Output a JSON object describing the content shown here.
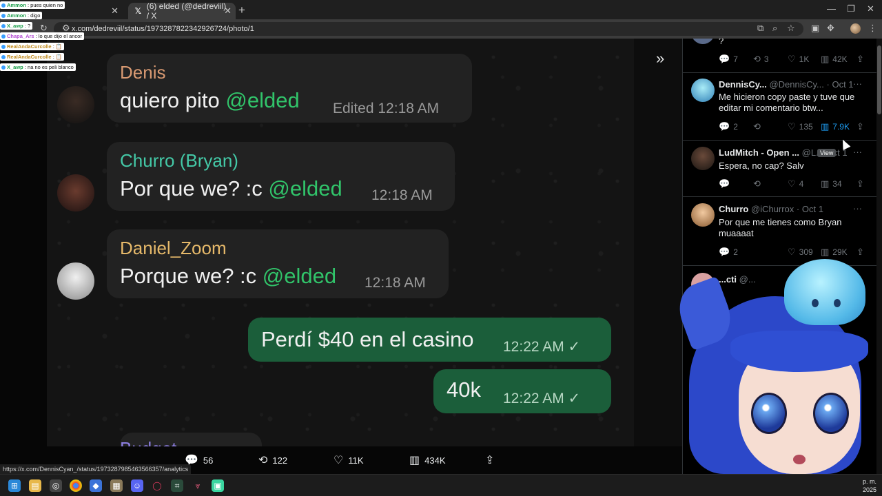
{
  "browser": {
    "tabs": [
      {
        "title": "",
        "active": false
      },
      {
        "title": "(6) elded (@dedreviil) / X",
        "active": true
      }
    ],
    "url": "x.com/dedreviil/status/1973287822342926724/photo/1",
    "status_url": "https://x.com/DennisCyan_/status/1973287985463566357/analytics"
  },
  "stream_chat": [
    {
      "user": "Ammon",
      "text": ": pues quien no"
    },
    {
      "user": "Ammon",
      "text": ": digo"
    },
    {
      "user": "X_awp",
      "text": ": ?"
    },
    {
      "user": "Chapa_Ars",
      "text": ": lo que dijo el ancor"
    },
    {
      "user": "RealAndaCurcolle",
      "text": ": 📋"
    },
    {
      "user": "RealAndaCurcolle",
      "text": ": 📋"
    },
    {
      "user": "X_awp",
      "text": ": na no es peli blanco"
    }
  ],
  "photo": {
    "messages": [
      {
        "sender": "Denis",
        "sender_color": "#d99a72",
        "text": "quiero pito ",
        "mention": "@elded",
        "time": "Edited  12:18 AM"
      },
      {
        "sender": "Churro (Bryan)",
        "sender_color": "#44c9a7",
        "text": "Por que we? :c ",
        "mention": "@elded",
        "time": "12:18 AM"
      },
      {
        "sender": "Daniel_Zoom",
        "sender_color": "#e6b96a",
        "text": "Porque we? :c ",
        "mention": "@elded",
        "time": "12:18 AM"
      },
      {
        "text": "Perdí $40 en el casino",
        "time": "12:22 AM ✓"
      },
      {
        "text": "40k",
        "time": "12:22 AM ✓"
      }
    ],
    "cut_sender": "Budget"
  },
  "viewer_actions": {
    "replies": "56",
    "reposts": "122",
    "likes": "11K",
    "views": "434K"
  },
  "replies": [
    {
      "name": "",
      "handle": "",
      "date": "",
      "text": "?",
      "counts": {
        "reply": "7",
        "repost": "3",
        "like": "1K",
        "views": "42K"
      }
    },
    {
      "name": "DennisCy...",
      "handle": "@DennisCy...",
      "date": "· Oct 1",
      "text": "Me hicieron copy paste y tuve que editar mi comentario btw...",
      "counts": {
        "reply": "2",
        "repost": "",
        "like": "135",
        "views": "7.9K"
      }
    },
    {
      "name": "LudMitch - Open ...",
      "handle": "@L...",
      "date": "Oct 1",
      "text": "Espera, no cap? Salv",
      "counts": {
        "reply": "",
        "repost": "",
        "like": "4",
        "views": "34"
      }
    },
    {
      "name": "Churro",
      "handle": "@iChurrox",
      "date": "· Oct 1",
      "text": "Por que me tienes como Bryan muaaaat",
      "counts": {
        "reply": "2",
        "repost": "",
        "like": "309",
        "views": "29K"
      }
    },
    {
      "name": "...cti",
      "handle": "@...",
      "date": "",
      "text": "...",
      "counts": {}
    }
  ],
  "tooltip": "View",
  "clock": {
    "time": "p. m.",
    "date": "2025"
  },
  "colors": {
    "accent": "#1d9bf0",
    "outgoing_bubble": "#1b5e3a",
    "mention": "#31c46a"
  }
}
